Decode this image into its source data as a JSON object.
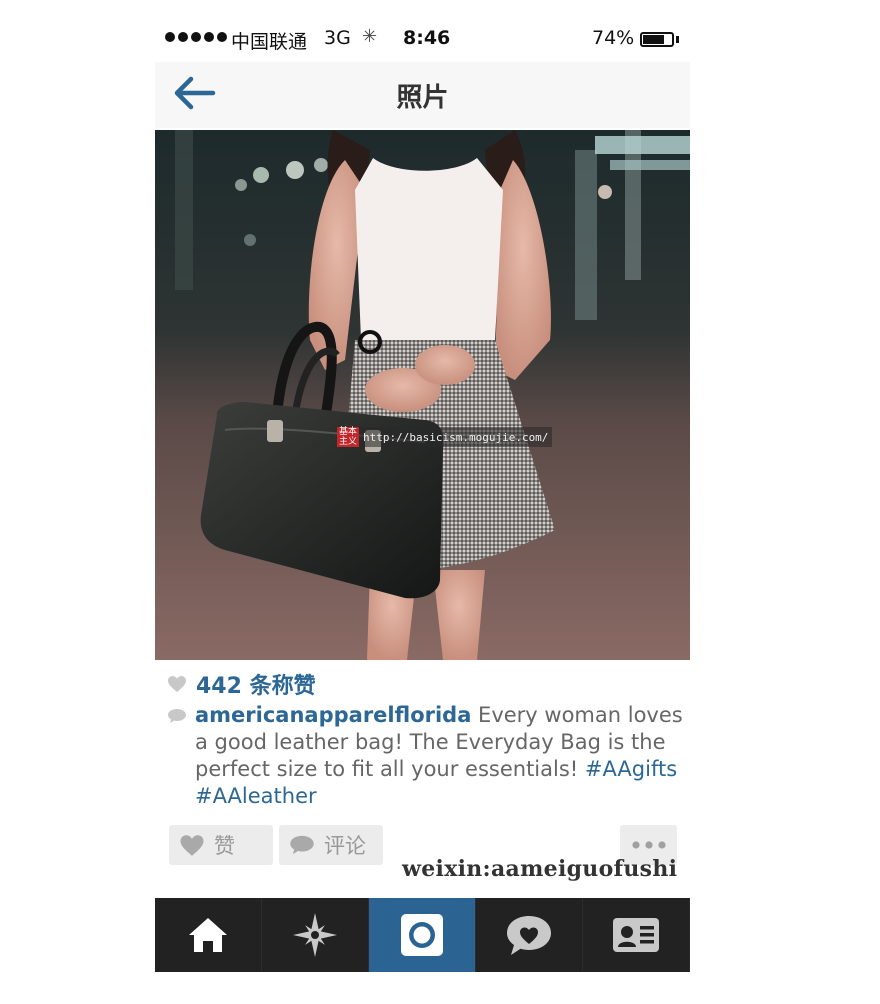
{
  "status_bar": {
    "carrier": "中国联通",
    "network": "3G",
    "time": "8:46",
    "battery_percent": "74%",
    "battery_level": 0.74
  },
  "nav": {
    "back_icon": "arrow-left-icon",
    "title": "照片"
  },
  "photo": {
    "watermark_logo": "基本主义",
    "watermark_url": "http://basicism.mogujie.com/"
  },
  "post": {
    "likes": "442 条称赞",
    "username": "americanapparelflorida",
    "caption": " Every woman loves a good leather bag! The Everyday Bag is the perfect size to fit all your essentials! ",
    "hashtags": "#AAgifts #AAleather"
  },
  "actions": {
    "like_label": "赞",
    "comment_label": "评论",
    "more_icon": "ellipsis-icon"
  },
  "overlay_text": "weixin:aameiguofushi",
  "tabbar": {
    "items": [
      {
        "icon": "home-icon",
        "active": false
      },
      {
        "icon": "explore-star-icon",
        "active": false
      },
      {
        "icon": "camera-icon",
        "active": true
      },
      {
        "icon": "activity-heart-icon",
        "active": false
      },
      {
        "icon": "profile-card-icon",
        "active": false
      }
    ]
  },
  "colors": {
    "accent_blue": "#2c6795",
    "active_tab": "#2b6392",
    "tabbar_bg": "#222222"
  }
}
